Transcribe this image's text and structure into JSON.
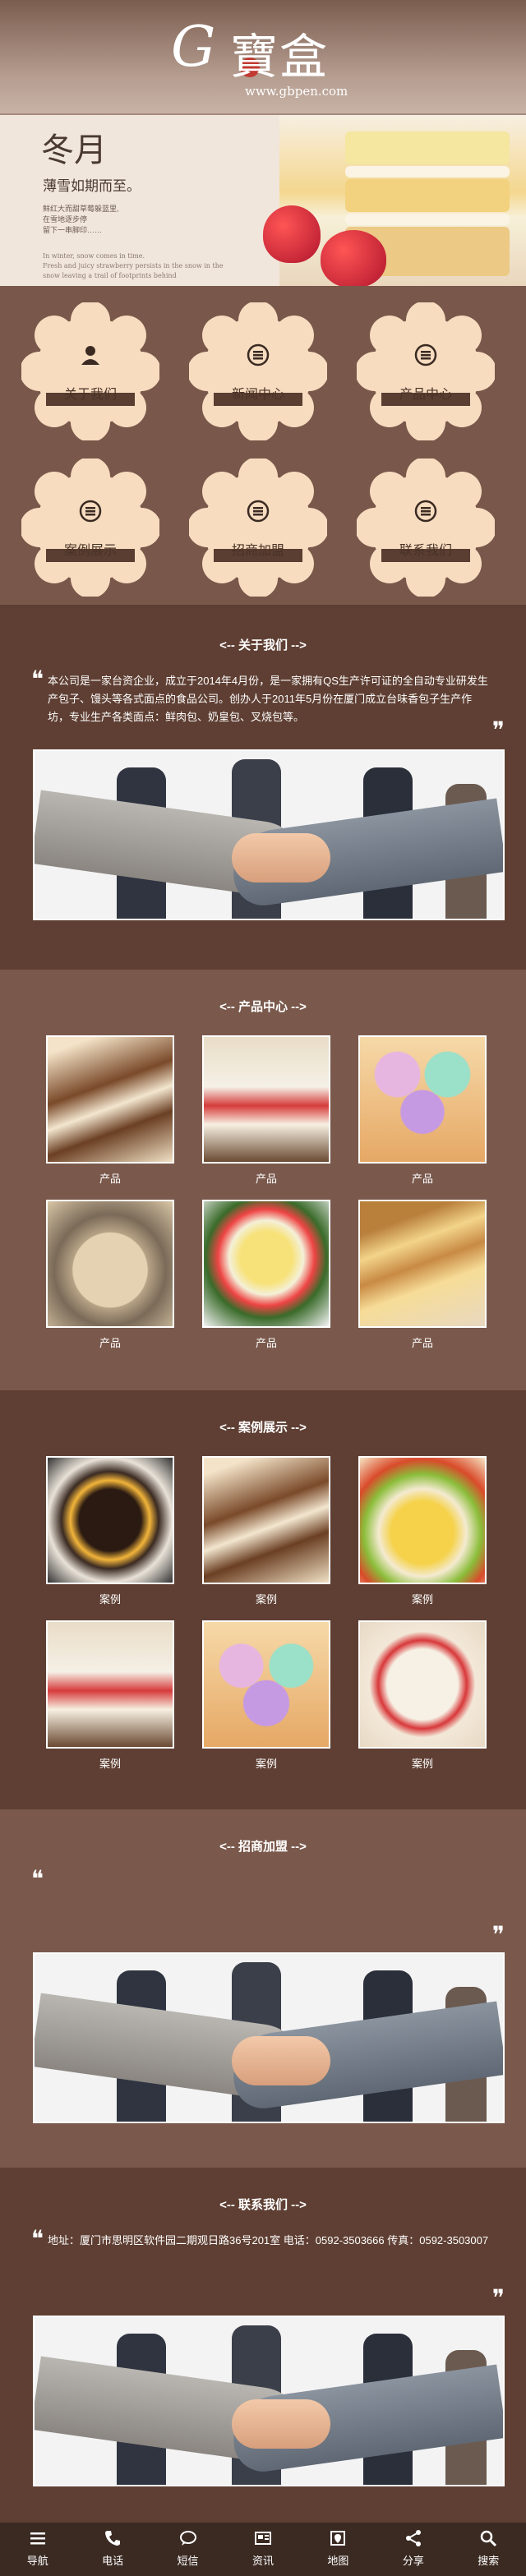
{
  "header": {
    "logo_letter": "G",
    "logo_text": "寶盒",
    "logo_url": "www.gbpen.com"
  },
  "banner": {
    "title": "冬月",
    "subtitle": "薄雪如期而至。",
    "small_lines": "鲜红大而甜草莓躲蓝里,\n在雪地逐步停\n留下一串脚印……",
    "en_lines": "In winter, snow comes in time.\nFresh and juicy strawberry persists in the snow in the\nsnow leaving a trail of footprints behind"
  },
  "menu": [
    {
      "label": "关于我们",
      "icon": "user-icon"
    },
    {
      "label": "新闻中心",
      "icon": "list-icon"
    },
    {
      "label": "产品中心",
      "icon": "list-icon"
    },
    {
      "label": "案例展示",
      "icon": "list-icon"
    },
    {
      "label": "招商加盟",
      "icon": "list-icon"
    },
    {
      "label": "联系我们",
      "icon": "list-icon"
    }
  ],
  "about": {
    "title": "<-- 关于我们 -->",
    "text": "本公司是一家台资企业，成立于2014年4月份，是一家拥有QS生产许可证的全自动专业研发生产包子、馒头等各式面点的食品公司。创办人于2011年5月份在厦门成立台味香包子生产作坊，专业生产各类面点：鲜肉包、奶皇包、叉烧包等。"
  },
  "products": {
    "title": "<-- 产品中心 -->",
    "items": [
      "产品",
      "产品",
      "产品",
      "产品",
      "产品",
      "产品"
    ]
  },
  "cases": {
    "title": "<-- 案例展示 -->",
    "items": [
      "案例",
      "案例",
      "案例",
      "案例",
      "案例",
      "案例"
    ]
  },
  "join": {
    "title": "<-- 招商加盟 -->",
    "text": ""
  },
  "contact": {
    "title": "<-- 联系我们 -->",
    "text": "地址：厦门市思明区软件园二期观日路36号201室 电话：0592-3503666 传真：0592-3503007"
  },
  "footer": [
    {
      "label": "导航",
      "icon": "menu-icon"
    },
    {
      "label": "电话",
      "icon": "phone-icon"
    },
    {
      "label": "短信",
      "icon": "chat-icon"
    },
    {
      "label": "资讯",
      "icon": "news-icon"
    },
    {
      "label": "地图",
      "icon": "map-icon"
    },
    {
      "label": "分享",
      "icon": "share-icon"
    },
    {
      "label": "搜索",
      "icon": "search-icon"
    }
  ]
}
